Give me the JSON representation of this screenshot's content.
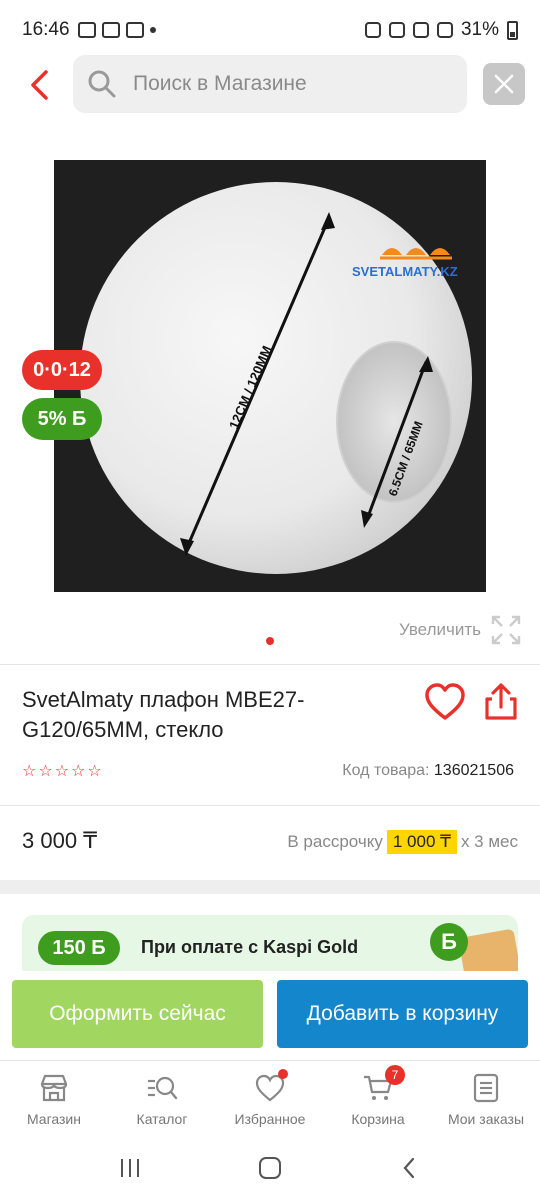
{
  "status_bar": {
    "time": "16:46",
    "battery": "31%"
  },
  "search": {
    "placeholder": "Поиск в Магазине"
  },
  "product": {
    "image_badges": {
      "installment": "0·0·12",
      "bonus": "5% Б"
    },
    "image_text": {
      "brand": "SVETALMATY.KZ",
      "diameter": "12CM / 120MM",
      "hole": "6.5CM / 65MM"
    },
    "zoom_label": "Увеличить",
    "title": "SvetAlmaty плафон MBE27-G120/65MM, стекло",
    "rating_stars": 0,
    "code_label": "Код товара:",
    "code_value": "136021506",
    "price": "3 000 ₸",
    "installment_prefix": "В рассрочку",
    "installment_amount": "1 000 ₸",
    "installment_suffix": "x 3 мес"
  },
  "promo": {
    "bonus": "150 Б",
    "text": "При оплате с Kaspi Gold",
    "coin": "Б"
  },
  "actions": {
    "buy_now": "Оформить сейчас",
    "add_to_cart": "Добавить в корзину"
  },
  "bottom_nav": {
    "items": [
      {
        "label": "Магазин"
      },
      {
        "label": "Каталог"
      },
      {
        "label": "Избранное"
      },
      {
        "label": "Корзина",
        "badge": "7"
      },
      {
        "label": "Мои заказы"
      }
    ]
  },
  "colors": {
    "accent_red": "#e8312a",
    "kaspi_green": "#3e9d1f",
    "buy_green": "#a1d760",
    "cart_blue": "#1486cc",
    "installment_yellow": "#ffd500"
  }
}
